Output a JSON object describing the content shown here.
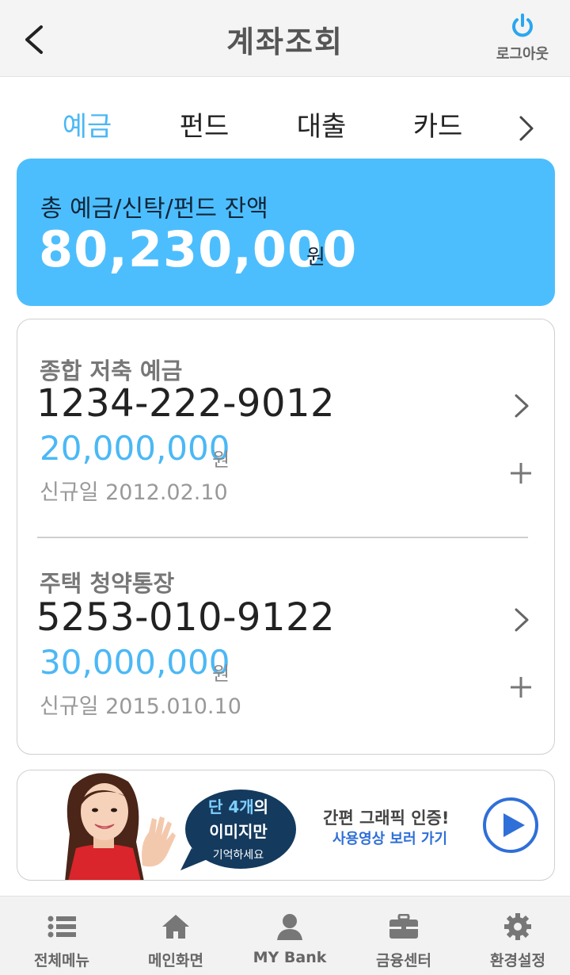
{
  "header": {
    "title": "계좌조회",
    "logout_label": "로그아웃"
  },
  "tabs": [
    {
      "label": "예금",
      "active": true
    },
    {
      "label": "펀드",
      "active": false
    },
    {
      "label": "대출",
      "active": false
    },
    {
      "label": "카드",
      "active": false
    }
  ],
  "summary": {
    "label": "총 예금/신탁/펀드 잔액",
    "amount": "80,230,000",
    "unit": "원"
  },
  "accounts": [
    {
      "name": "종합 저축 예금",
      "number": "1234-222-9012",
      "balance": "20,000,000",
      "unit": "원",
      "opened": "신규일 2012.02.10"
    },
    {
      "name": "주택 청약통장",
      "number": "5253-010-9122",
      "balance": "30,000,000",
      "unit": "원",
      "opened": "신규일 2015.010.10"
    }
  ],
  "banner": {
    "bubble_prefix": "단 4개",
    "bubble_suffix": "의",
    "bubble_line2": "이미지만",
    "bubble_line3": "기억하세요",
    "title": "간편 그래픽 인증!",
    "subtitle": "사용영상 보러 가기"
  },
  "bottom_nav": [
    {
      "label": "전체메뉴",
      "icon": "list-icon"
    },
    {
      "label": "메인화면",
      "icon": "home-icon"
    },
    {
      "label": "MY Bank",
      "icon": "user-icon"
    },
    {
      "label": "금융센터",
      "icon": "briefcase-icon"
    },
    {
      "label": "환경설정",
      "icon": "gear-icon"
    }
  ],
  "colors": {
    "accent": "#4bb8f5",
    "summary_bg": "#4dbefd",
    "bubble_bg": "#143a5e",
    "play": "#2f6fd8"
  }
}
